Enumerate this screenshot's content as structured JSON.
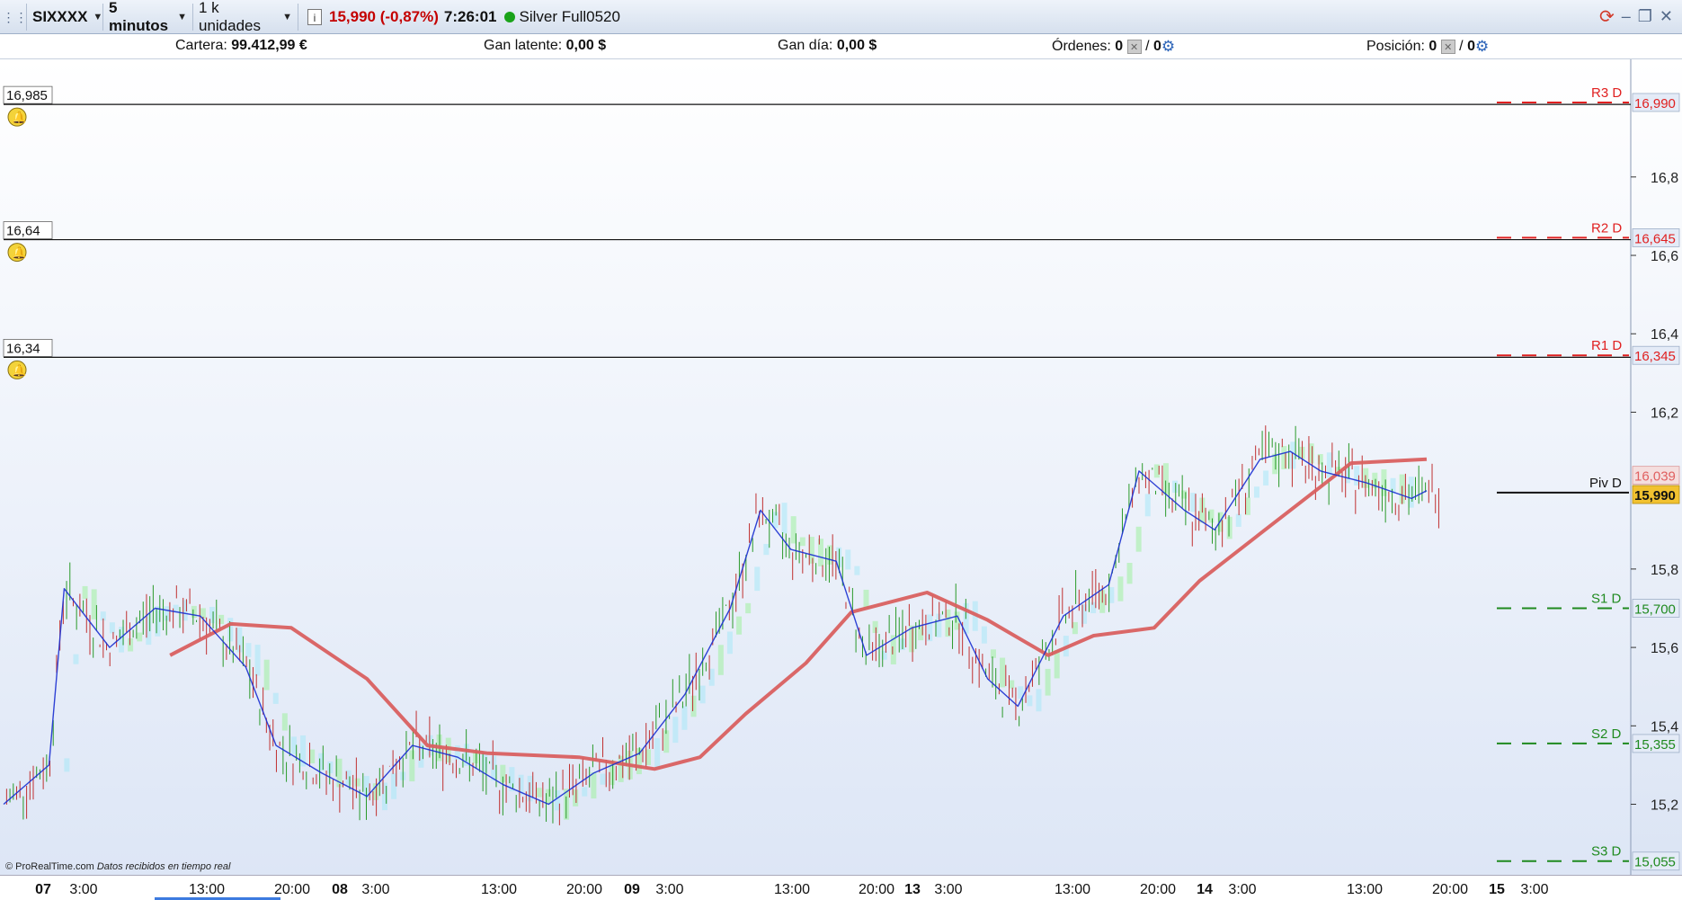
{
  "toolbar": {
    "ticker": "SIXXXX",
    "timeframe": "5 minutos",
    "units": "1 k unidades",
    "info_icon": "info-icon",
    "price_change": "15,990 (-0,87%)",
    "clock": "7:26:01",
    "instrument": "Silver Full0520",
    "status_color": "#1aa31a"
  },
  "infobar": {
    "cartera_label": "Cartera:",
    "cartera_value": "99.412,99 €",
    "gan_latente_label": "Gan latente:",
    "gan_latente_value": "0,00 $",
    "gan_dia_label": "Gan día:",
    "gan_dia_value": "0,00 $",
    "ordenes_label": "Órdenes:",
    "ordenes_value": "0",
    "ordenes_value2": "0",
    "posicion_label": "Posición:",
    "posicion_value": "0",
    "posicion_value2": "0"
  },
  "alerts": [
    {
      "value": "16,985"
    },
    {
      "value": "16,64"
    },
    {
      "value": "16,34"
    }
  ],
  "pivots": [
    {
      "label": "R3 D",
      "value": "16,990",
      "color": "#e02020"
    },
    {
      "label": "R2 D",
      "value": "16,645",
      "color": "#e02020"
    },
    {
      "label": "R1 D",
      "value": "16,345",
      "color": "#e02020"
    },
    {
      "label": "Piv D",
      "value": "",
      "color": "#111111"
    },
    {
      "label": "S1 D",
      "value": "15,700",
      "color": "#1f8a1f"
    },
    {
      "label": "S2 D",
      "value": "15,355",
      "color": "#1f8a1f"
    },
    {
      "label": "S3 D",
      "value": "15,055",
      "color": "#1f8a1f"
    }
  ],
  "price_tags": {
    "ma_value": "16,039",
    "last_price": "15,990"
  },
  "credit": {
    "site": "© ProRealTime.com",
    "note": "Datos recibidos en tiempo real"
  },
  "chart_data": {
    "type": "line",
    "yticks": [
      "16,8",
      "16,6",
      "16,4",
      "16,2",
      "15,8",
      "15,6",
      "15,4",
      "15,2"
    ],
    "xticks": [
      {
        "label": "07",
        "bold": true
      },
      {
        "label": "3:00",
        "bold": false
      },
      {
        "label": "13:00",
        "bold": false
      },
      {
        "label": "20:00",
        "bold": false
      },
      {
        "label": "08",
        "bold": true
      },
      {
        "label": "3:00",
        "bold": false
      },
      {
        "label": "13:00",
        "bold": false
      },
      {
        "label": "20:00",
        "bold": false
      },
      {
        "label": "09",
        "bold": true
      },
      {
        "label": "3:00",
        "bold": false
      },
      {
        "label": "13:00",
        "bold": false
      },
      {
        "label": "20:00",
        "bold": false
      },
      {
        "label": "13",
        "bold": true
      },
      {
        "label": "3:00",
        "bold": false
      },
      {
        "label": "13:00",
        "bold": false
      },
      {
        "label": "20:00",
        "bold": false
      },
      {
        "label": "14",
        "bold": true
      },
      {
        "label": "3:00",
        "bold": false
      },
      {
        "label": "13:00",
        "bold": false
      },
      {
        "label": "20:00",
        "bold": false
      },
      {
        "label": "15",
        "bold": true
      },
      {
        "label": "3:00",
        "bold": false
      }
    ],
    "ylim": [
      15.02,
      17.1
    ],
    "series": [
      {
        "color": "#d96060",
        "values": [
          [
            0.11,
            15.58
          ],
          [
            0.15,
            15.66
          ],
          [
            0.19,
            15.65
          ],
          [
            0.24,
            15.52
          ],
          [
            0.28,
            15.35
          ],
          [
            0.32,
            15.33
          ],
          [
            0.38,
            15.32
          ],
          [
            0.43,
            15.29
          ],
          [
            0.46,
            15.32
          ],
          [
            0.49,
            15.43
          ],
          [
            0.53,
            15.56
          ],
          [
            0.56,
            15.69
          ],
          [
            0.61,
            15.74
          ],
          [
            0.65,
            15.67
          ],
          [
            0.69,
            15.58
          ],
          [
            0.72,
            15.63
          ],
          [
            0.76,
            15.65
          ],
          [
            0.79,
            15.77
          ],
          [
            0.83,
            15.89
          ],
          [
            0.87,
            16.01
          ],
          [
            0.89,
            16.07
          ],
          [
            0.94,
            16.08
          ]
        ]
      },
      {
        "color": "#1a2fd0",
        "values": [
          [
            0.0,
            15.2
          ],
          [
            0.03,
            15.3
          ],
          [
            0.04,
            15.75
          ],
          [
            0.07,
            15.6
          ],
          [
            0.1,
            15.7
          ],
          [
            0.13,
            15.68
          ],
          [
            0.16,
            15.55
          ],
          [
            0.18,
            15.35
          ],
          [
            0.21,
            15.28
          ],
          [
            0.24,
            15.22
          ],
          [
            0.27,
            15.35
          ],
          [
            0.3,
            15.32
          ],
          [
            0.33,
            15.25
          ],
          [
            0.36,
            15.2
          ],
          [
            0.39,
            15.28
          ],
          [
            0.42,
            15.33
          ],
          [
            0.45,
            15.48
          ],
          [
            0.48,
            15.7
          ],
          [
            0.5,
            15.95
          ],
          [
            0.52,
            15.85
          ],
          [
            0.55,
            15.82
          ],
          [
            0.57,
            15.58
          ],
          [
            0.6,
            15.65
          ],
          [
            0.63,
            15.68
          ],
          [
            0.65,
            15.52
          ],
          [
            0.67,
            15.45
          ],
          [
            0.7,
            15.68
          ],
          [
            0.73,
            15.76
          ],
          [
            0.75,
            16.05
          ],
          [
            0.78,
            15.95
          ],
          [
            0.8,
            15.9
          ],
          [
            0.83,
            16.08
          ],
          [
            0.85,
            16.1
          ],
          [
            0.87,
            16.05
          ],
          [
            0.9,
            16.02
          ],
          [
            0.93,
            15.98
          ],
          [
            0.94,
            16.0
          ]
        ]
      }
    ]
  }
}
